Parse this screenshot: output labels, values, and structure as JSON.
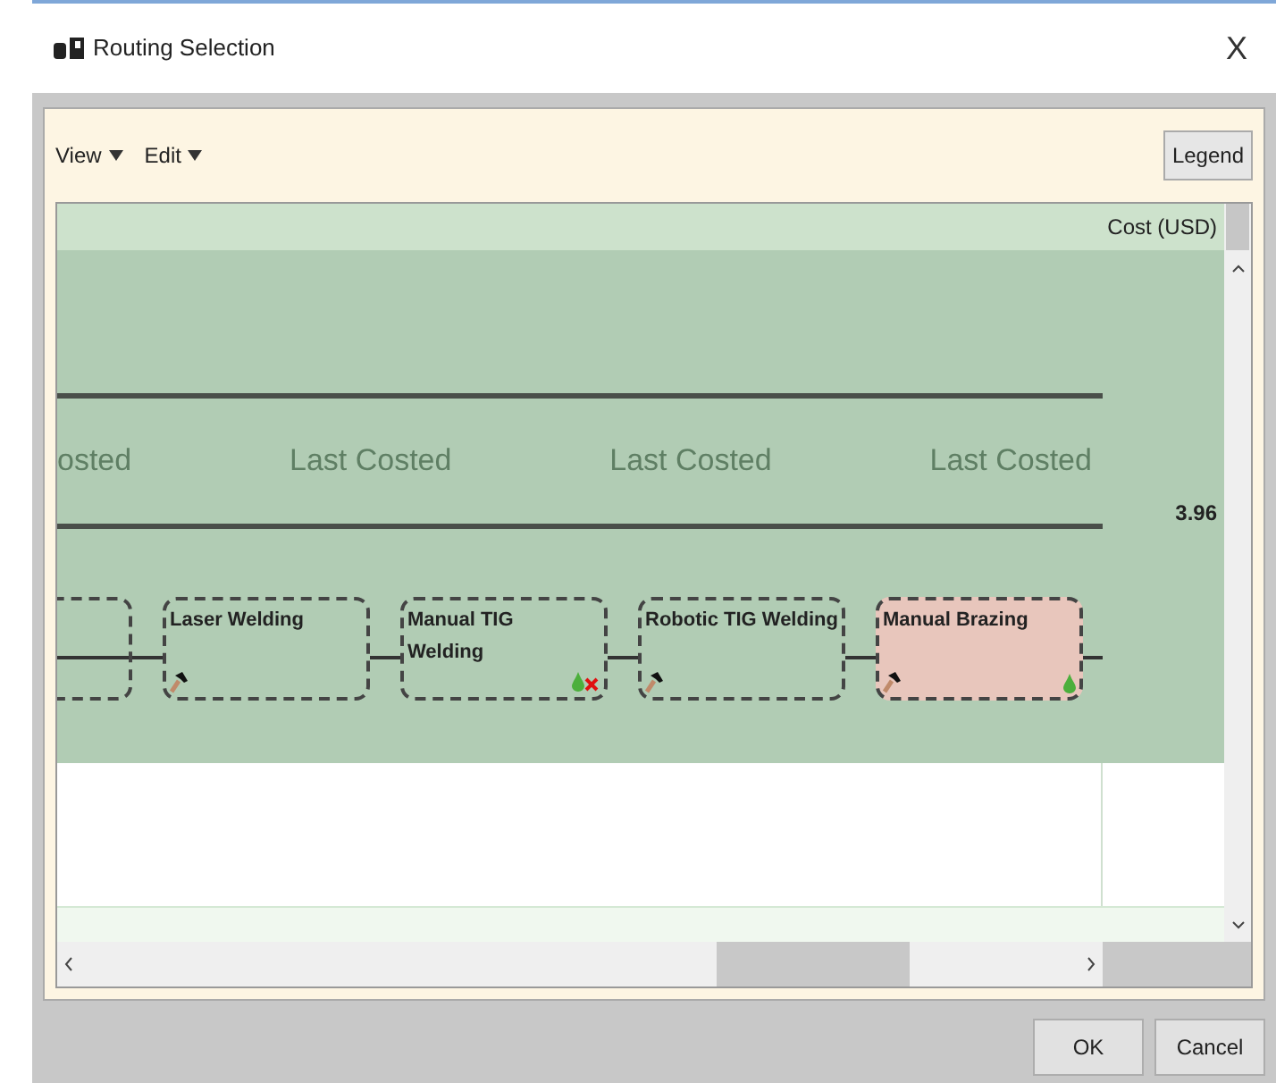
{
  "window": {
    "title": "Routing Selection",
    "close": "X"
  },
  "menu": [
    {
      "label": "View"
    },
    {
      "label": "Edit"
    }
  ],
  "legend_button": "Legend",
  "grid": {
    "cost_header": "Cost (USD)",
    "lane_labels": [
      "osted",
      "Last Costed",
      "Last Costed",
      "Last Costed"
    ],
    "cost": "3.96",
    "nodes": [
      {
        "kind": "partial"
      },
      {
        "kind": "step",
        "label": "Laser Welding",
        "tool": true,
        "drop": false,
        "error": false,
        "highlighted": false
      },
      {
        "kind": "step",
        "label": "Manual TIG Welding",
        "tool": false,
        "drop": true,
        "error": true,
        "highlighted": false
      },
      {
        "kind": "step",
        "label": "Robotic TIG Welding",
        "tool": true,
        "drop": false,
        "error": false,
        "highlighted": false
      },
      {
        "kind": "step",
        "label": "Manual Brazing",
        "tool": true,
        "drop": true,
        "error": false,
        "highlighted": true
      }
    ]
  },
  "buttons": [
    "OK",
    "Cancel"
  ]
}
